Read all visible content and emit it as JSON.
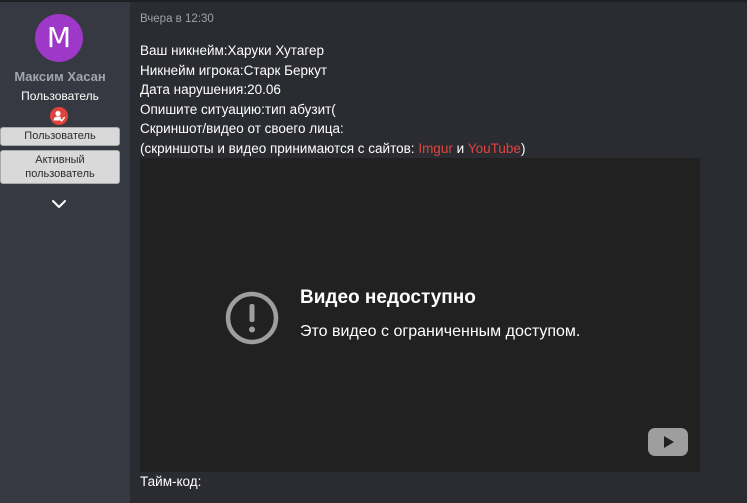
{
  "user": {
    "avatar_letter": "M",
    "avatar_color": "#9e38c9",
    "name": "Максим Хасан",
    "title": "Пользователь",
    "role_icon": "user-badge-icon",
    "banners": [
      "Пользователь",
      "Активный пользователь"
    ],
    "expand_icon": "chevron-down-icon"
  },
  "message": {
    "date": "Вчера в 12:30",
    "lines": [
      "Ваш никнейм:Харуки Хутагер",
      "Никнейм игрока:Старк Беркут",
      "Дата нарушения:20.06",
      "Опишите ситуацию:тип абузит(",
      "Скриншот/видео от своего лица:"
    ],
    "note_prefix": "(скриншоты и видео принимаются с сайтов: ",
    "link_imgur": "Imgur",
    "note_and": " и ",
    "link_youtube": "YouTube",
    "note_suffix": ")",
    "timecode_label": "Тайм-код:"
  },
  "video": {
    "title": "Видео недоступно",
    "subtitle": "Это видео с ограниченным доступом.",
    "alert_icon": "alert-circle-icon",
    "logo_icon": "youtube-logo-icon"
  },
  "colors": {
    "link": "#e0443f",
    "background": "#2b2c31",
    "sidebar": "#363941",
    "video_bg": "#212121"
  }
}
